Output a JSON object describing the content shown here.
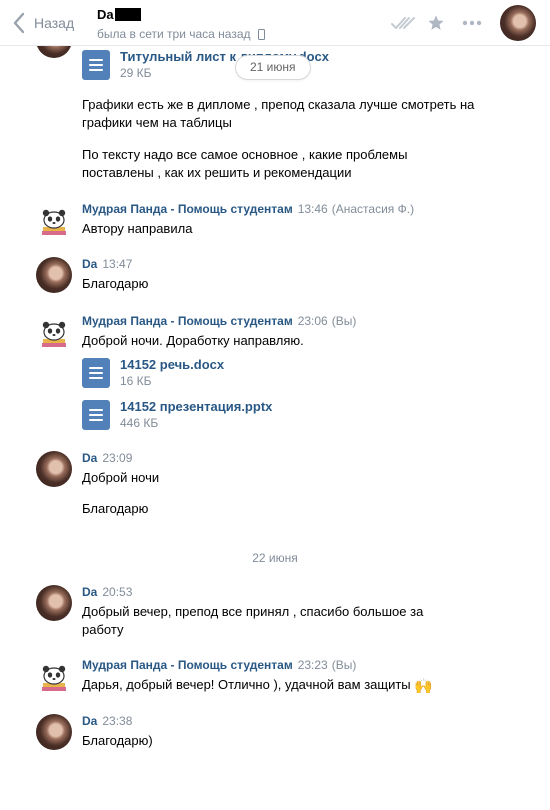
{
  "header": {
    "back_label": "Назад",
    "peer_name": "Da",
    "peer_status": "была в сети три часа назад"
  },
  "floating_date": "21 июня",
  "top_doc": {
    "title": "Титульный лист к диплому.docx",
    "size": "29 КБ"
  },
  "cont_texts": [
    "Графики есть же в дипломе , препод сказала лучше смотреть на графики чем на таблицы",
    "По тексту надо все самое основное , какие проблемы поставлены , как их решить и рекомендации"
  ],
  "messages": [
    {
      "author": "Мудрая Панда - Помощь студентам",
      "time": "13:46",
      "extra": "(Анастасия Ф.)",
      "texts": [
        "Автору направила"
      ]
    },
    {
      "author": "Da",
      "time": "13:47",
      "texts": [
        "Благодарю"
      ]
    },
    {
      "author": "Мудрая Панда - Помощь студентам",
      "time": "23:06",
      "extra": "(Вы)",
      "texts": [
        "Доброй ночи. Доработку направляю."
      ],
      "docs": [
        {
          "title": "14152 речь.docx",
          "size": "16 КБ"
        },
        {
          "title": "14152 презентация.pptx",
          "size": "446 КБ"
        }
      ]
    },
    {
      "author": "Da",
      "time": "23:09",
      "texts": [
        "Доброй ночи",
        "Благодарю"
      ]
    },
    {
      "author": "Da",
      "time": "20:53",
      "texts": [
        "Добрый вечер, препод все принял , спасибо большое за работу"
      ]
    },
    {
      "author": "Мудрая Панда - Помощь студентам",
      "time": "23:23",
      "extra": "(Вы)",
      "texts": [
        "Дарья, добрый вечер! Отлично ), удачной вам защиты"
      ],
      "emoji": "🙌"
    },
    {
      "author": "Da",
      "time": "23:38",
      "texts": [
        "Благодарю)"
      ]
    }
  ],
  "date_separator": "22 июня",
  "icons": [
    "back-chevron-icon",
    "phone-icon",
    "double-check-icon",
    "star-icon",
    "more-icon",
    "document-icon"
  ],
  "colors": {
    "link": "#2a5885",
    "muted": "#818c99",
    "doc_icon": "#5181b8",
    "icon_gray": "#aeb7c2"
  }
}
